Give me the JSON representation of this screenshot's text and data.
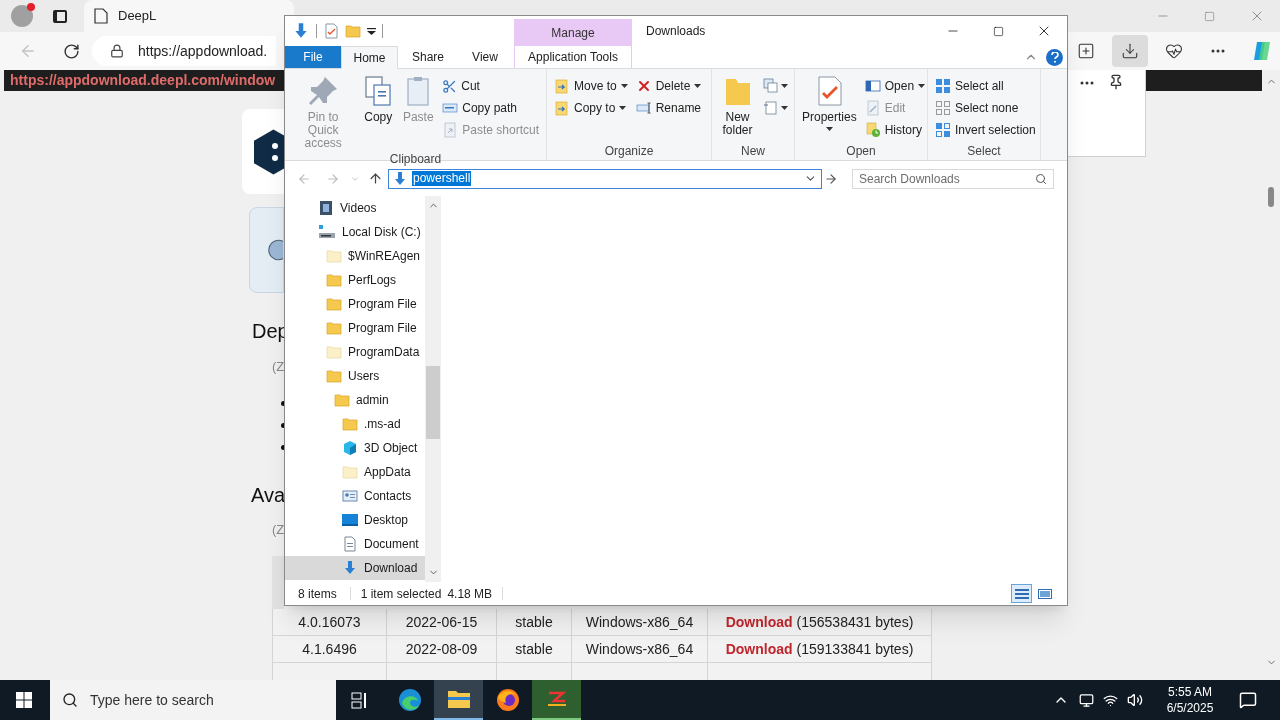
{
  "browser": {
    "tabs": [
      {
        "title": "DeepL",
        "selected": true
      }
    ],
    "address": "https://appdownload.",
    "toolbar": [
      {
        "kind": "split",
        "active": false
      },
      {
        "kind": "downloads",
        "active": true
      },
      {
        "kind": "health",
        "active": false
      },
      {
        "kind": "more",
        "active": false
      },
      {
        "kind": "copilot",
        "active": false
      }
    ],
    "page": {
      "url_banner": "https://appdownload.deepl.com/window",
      "heading_1": "Dep",
      "note_1": "(Z",
      "heading_2": "Ava",
      "note_2": "(Z",
      "table_rows": [
        {
          "cells": [
            "4.0.16073",
            "2022-06-15",
            "stable",
            "Windows-x86_64"
          ],
          "link": "Download",
          "size": "(156538431 bytes)"
        },
        {
          "cells": [
            "4.1.6496",
            "2022-08-09",
            "stable",
            "Windows-x86_64"
          ],
          "link": "Download",
          "size": "(159133841 bytes)"
        }
      ]
    }
  },
  "explorer": {
    "title": "Downloads",
    "contextual_header": "Manage",
    "tabs": [
      {
        "label": "File",
        "kind": "file",
        "selected": false
      },
      {
        "label": "Home",
        "kind": "normal",
        "selected": true
      },
      {
        "label": "Share",
        "kind": "normal",
        "selected": false
      },
      {
        "label": "View",
        "kind": "normal",
        "selected": false
      },
      {
        "label": "Application Tools",
        "kind": "contextual",
        "selected": false
      }
    ],
    "ribbon": [
      {
        "label": "Clipboard",
        "columns": [
          [
            {
              "label": "Pin to Quick access",
              "kind": "large",
              "disabled": true
            }
          ],
          [
            {
              "label": "Copy",
              "kind": "large",
              "disabled": false
            }
          ],
          [
            {
              "label": "Paste",
              "kind": "large",
              "disabled": true
            }
          ],
          [
            {
              "label": "Cut",
              "kind": "small",
              "disabled": false
            },
            {
              "label": "Copy path",
              "kind": "small",
              "disabled": false
            },
            {
              "label": "Paste shortcut",
              "kind": "small",
              "disabled": true
            }
          ]
        ]
      },
      {
        "label": "Organize",
        "columns": [
          [
            {
              "label": "Move to",
              "kind": "small",
              "disabled": false,
              "dropdown": true
            },
            {
              "label": "Copy to",
              "kind": "small",
              "disabled": false,
              "dropdown": true
            }
          ],
          [
            {
              "label": "Delete",
              "kind": "small",
              "disabled": false,
              "dropdown": true
            },
            {
              "label": "Rename",
              "kind": "small",
              "disabled": false
            }
          ]
        ]
      },
      {
        "label": "New",
        "columns": [
          [
            {
              "label": "New folder",
              "kind": "large",
              "disabled": false
            }
          ],
          [
            {
              "kind": "icon",
              "dropdown": true
            },
            {
              "kind": "icon",
              "dropdown": true
            }
          ]
        ]
      },
      {
        "label": "Open",
        "columns": [
          [
            {
              "label": "Properties",
              "kind": "large",
              "disabled": false,
              "dropdown": true
            }
          ],
          [
            {
              "label": "Open",
              "kind": "small",
              "disabled": false,
              "dropdown": true
            },
            {
              "label": "Edit",
              "kind": "small",
              "disabled": true
            },
            {
              "label": "History",
              "kind": "small",
              "disabled": false
            }
          ]
        ]
      },
      {
        "label": "Select",
        "columns": [
          [
            {
              "label": "Select all",
              "kind": "small",
              "disabled": false
            },
            {
              "label": "Select none",
              "kind": "small",
              "disabled": false
            },
            {
              "label": "Invert selection",
              "kind": "small",
              "disabled": false
            }
          ]
        ]
      }
    ],
    "address": "powershell",
    "search_placeholder": "Search Downloads",
    "tree": [
      {
        "label": "Videos",
        "kind": "video",
        "selected": false
      },
      {
        "label": "Local Disk (C:)",
        "kind": "drive",
        "selected": false,
        "children": [
          {
            "label": "$WinREAgen",
            "kind": "folder",
            "hidden": true,
            "selected": false
          },
          {
            "label": "PerfLogs",
            "kind": "folder",
            "hidden": false,
            "selected": false
          },
          {
            "label": "Program File",
            "kind": "folder",
            "hidden": false,
            "selected": false
          },
          {
            "label": "Program File",
            "kind": "folder",
            "hidden": false,
            "selected": false
          },
          {
            "label": "ProgramData",
            "kind": "folder",
            "hidden": true,
            "selected": false
          },
          {
            "label": "Users",
            "kind": "folder",
            "hidden": false,
            "selected": false,
            "children": [
              {
                "label": "admin",
                "kind": "folder",
                "hidden": false,
                "selected": false,
                "children": [
                  {
                    "label": ".ms-ad",
                    "kind": "folder",
                    "hidden": false,
                    "selected": false
                  },
                  {
                    "label": "3D Object",
                    "kind": "cube",
                    "selected": false
                  },
                  {
                    "label": "AppData",
                    "kind": "folder",
                    "hidden": true,
                    "selected": false
                  },
                  {
                    "label": "Contacts",
                    "kind": "contacts",
                    "selected": false
                  },
                  {
                    "label": "Desktop",
                    "kind": "desktop",
                    "selected": false
                  },
                  {
                    "label": "Document",
                    "kind": "documents",
                    "selected": false
                  },
                  {
                    "label": "Download",
                    "kind": "downloads",
                    "selected": true
                  }
                ]
              }
            ]
          }
        ]
      }
    ],
    "status": {
      "count": "8 items",
      "selection": "1 item selected",
      "size": "4.18 MB"
    },
    "views": [
      {
        "kind": "details",
        "selected": true
      },
      {
        "kind": "large",
        "selected": false
      }
    ]
  },
  "taskbar": {
    "search_placeholder": "Type here to search",
    "apps": [
      {
        "kind": "taskview",
        "active": false
      },
      {
        "kind": "edge",
        "active": false
      },
      {
        "kind": "explorer",
        "active": true
      },
      {
        "kind": "firefox",
        "active": false
      },
      {
        "kind": "app",
        "active": false
      }
    ],
    "time": "5:55 AM",
    "date": "6/5/2025"
  }
}
